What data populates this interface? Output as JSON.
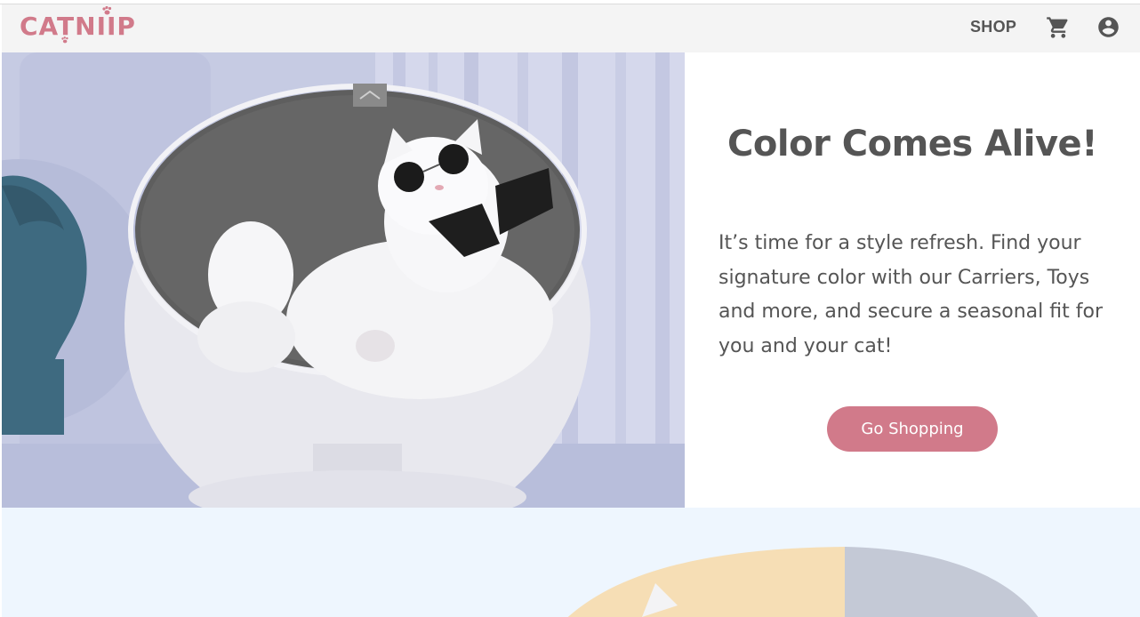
{
  "brand": {
    "logo_text": "CATNIIP",
    "accent_color": "#d17a8a"
  },
  "nav": {
    "shop_label": "SHOP",
    "cart_icon": "shopping-cart-icon",
    "account_icon": "account-circle-icon"
  },
  "hero": {
    "title": "Color Comes Alive!",
    "body": "It’s time for a style refresh. Find your signature color with our Carriers, Toys and more, and secure a seasonal fit for you and your cat!",
    "cta_label": "Go Shopping",
    "image_alt": "White cat wearing sunglasses and a bow tie lounging in a round pet bed"
  }
}
